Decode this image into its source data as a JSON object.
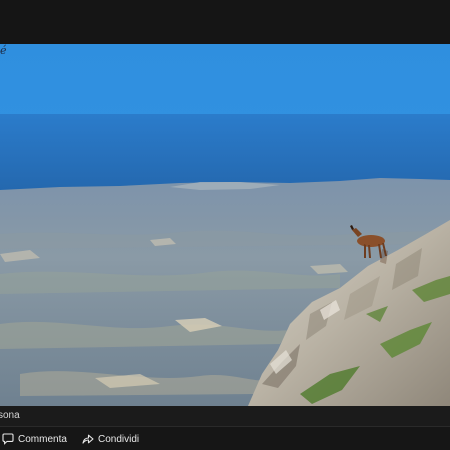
{
  "photo": {
    "watermark_text": "é",
    "subject": "chamois on rocky mountain ridge above coastal plain"
  },
  "caption": {
    "text": "sona"
  },
  "actions": {
    "comment_label": "Commenta",
    "share_label": "Condividi"
  },
  "icons": {
    "comment": "comment-bubble-icon",
    "share": "share-arrow-icon"
  },
  "colors": {
    "sky": "#2f8fde",
    "sea": "#2b78c4",
    "rock": "#c8c2b6",
    "chamois": "#8a4f2a"
  }
}
